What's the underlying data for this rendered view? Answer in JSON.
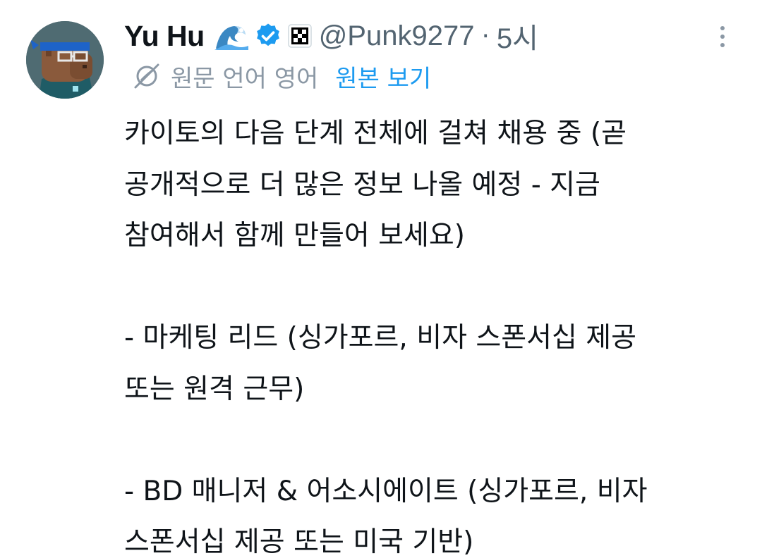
{
  "author": {
    "display_name": "Yu Hu",
    "handle": "@Punk9277",
    "separator": "·",
    "time": "5시"
  },
  "icons": {
    "avatar": "capybara-avatar",
    "emoji": "wave-emoji-icon",
    "verified": "verified-badge-icon",
    "affiliate": "okx-badge-icon",
    "more": "more-vertical-icon",
    "translate": "translate-icon"
  },
  "translation": {
    "label": "원문 언어 영어",
    "show_original": "원본 보기"
  },
  "colors": {
    "text": "#0f1419",
    "secondary": "#536471",
    "link": "#1d9bf0",
    "verified": "#1d9bf0"
  },
  "post": {
    "lines": [
      "카이토의 다음 단계 전체에 걸쳐 채용 중 (곧",
      "공개적으로 더 많은 정보 나올 예정 - 지금",
      "참여해서 함께 만들어 보세요)",
      "",
      "- 마케팅 리드 (싱가포르, 비자 스폰서십 제공",
      "또는 원격 근무)",
      "",
      "- BD 매니저 & 어소시에이트 (싱가포르, 비자",
      "스폰서십 제공 또는 미국 기반)"
    ]
  }
}
